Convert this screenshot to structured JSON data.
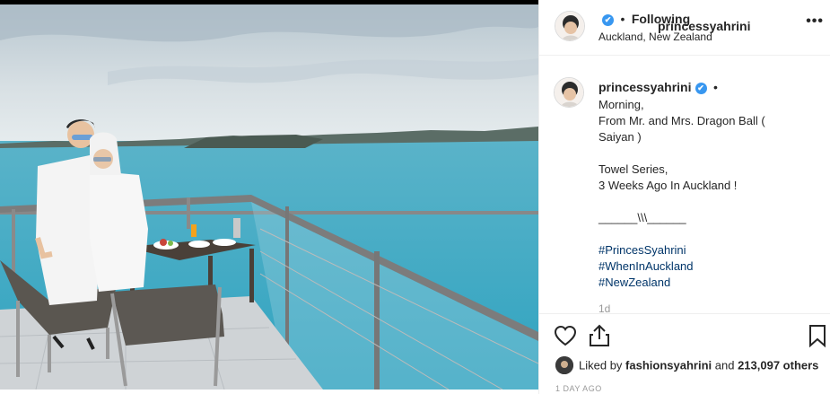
{
  "post": {
    "username": "princessyahrini",
    "verified_glyph": "✔",
    "dot": "•",
    "follow_state": "Following",
    "location": "Auckland, New Zealand",
    "more_glyph": "•••"
  },
  "caption": {
    "username": "princessyahrini",
    "dot": "•",
    "lines": [
      "Morning,",
      "From Mr. and Mrs. Dragon Ball (",
      "Saiyan )",
      "",
      "Towel Series,",
      "3 Weeks Ago In Auckland !",
      "",
      "______\\\\\\______",
      "",
      "#PrincesSyahrini",
      "#WhenInAuckland",
      "#NewZealand"
    ],
    "time_short": "1d"
  },
  "actions": {
    "like_icon": "heart-icon",
    "share_icon": "share-icon",
    "save_icon": "bookmark-icon"
  },
  "likes": {
    "prefix": "Liked by",
    "user": "fashionsyahrini",
    "middle": "and",
    "count": "213,097 others"
  },
  "date": "1 DAY AGO",
  "colors": {
    "text": "#262626",
    "verified": "#3897f0",
    "hashtag": "#003569",
    "muted": "#999999",
    "divider": "#efefef"
  }
}
